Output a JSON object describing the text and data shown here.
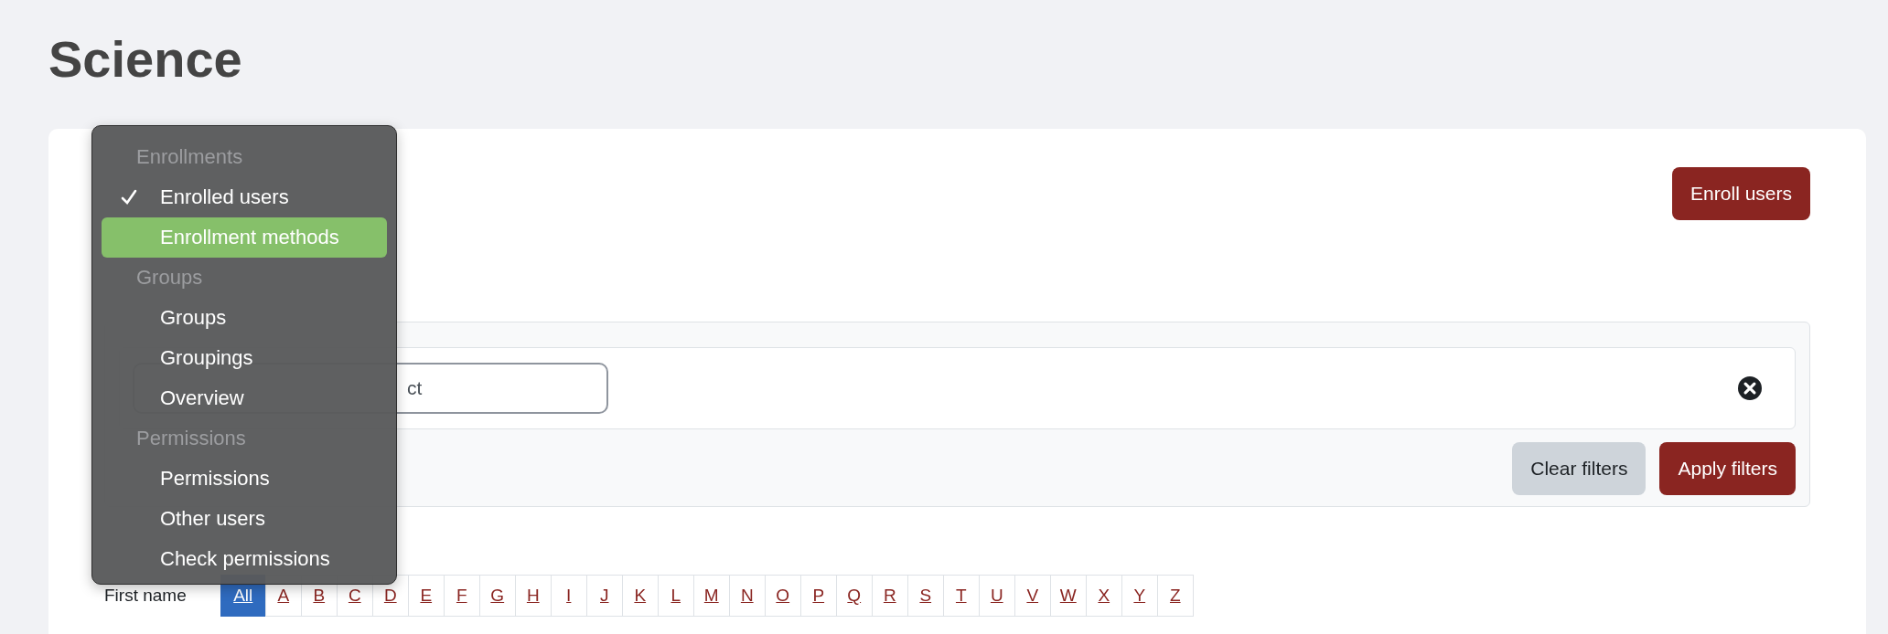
{
  "page_title": "Science",
  "enroll_button": "Enroll users",
  "filter": {
    "field_value": "ct",
    "clear_button": "Clear filters",
    "apply_button": "Apply filters"
  },
  "initials": {
    "label": "First name",
    "letters": [
      {
        "text": "All",
        "selected": true
      },
      {
        "text": "A",
        "selected": false
      },
      {
        "text": "B",
        "selected": false
      },
      {
        "text": "C",
        "selected": false
      },
      {
        "text": "D",
        "selected": false
      },
      {
        "text": "E",
        "selected": false
      },
      {
        "text": "F",
        "selected": false
      },
      {
        "text": "G",
        "selected": false
      },
      {
        "text": "H",
        "selected": false
      },
      {
        "text": "I",
        "selected": false
      },
      {
        "text": "J",
        "selected": false
      },
      {
        "text": "K",
        "selected": false
      },
      {
        "text": "L",
        "selected": false
      },
      {
        "text": "M",
        "selected": false
      },
      {
        "text": "N",
        "selected": false
      },
      {
        "text": "O",
        "selected": false
      },
      {
        "text": "P",
        "selected": false
      },
      {
        "text": "Q",
        "selected": false
      },
      {
        "text": "R",
        "selected": false
      },
      {
        "text": "S",
        "selected": false
      },
      {
        "text": "T",
        "selected": false
      },
      {
        "text": "U",
        "selected": false
      },
      {
        "text": "V",
        "selected": false
      },
      {
        "text": "W",
        "selected": false
      },
      {
        "text": "X",
        "selected": false
      },
      {
        "text": "Y",
        "selected": false
      },
      {
        "text": "Z",
        "selected": false
      }
    ]
  },
  "menu": {
    "sections": [
      {
        "header": "Enrollments",
        "items": [
          {
            "label": "Enrolled users",
            "checked": true,
            "selected": false
          },
          {
            "label": "Enrollment methods",
            "checked": false,
            "selected": true
          }
        ]
      },
      {
        "header": "Groups",
        "items": [
          {
            "label": "Groups",
            "checked": false,
            "selected": false
          },
          {
            "label": "Groupings",
            "checked": false,
            "selected": false
          },
          {
            "label": "Overview",
            "checked": false,
            "selected": false
          }
        ]
      },
      {
        "header": "Permissions",
        "items": [
          {
            "label": "Permissions",
            "checked": false,
            "selected": false
          },
          {
            "label": "Other users",
            "checked": false,
            "selected": false
          },
          {
            "label": "Check permissions",
            "checked": false,
            "selected": false
          }
        ]
      }
    ]
  }
}
